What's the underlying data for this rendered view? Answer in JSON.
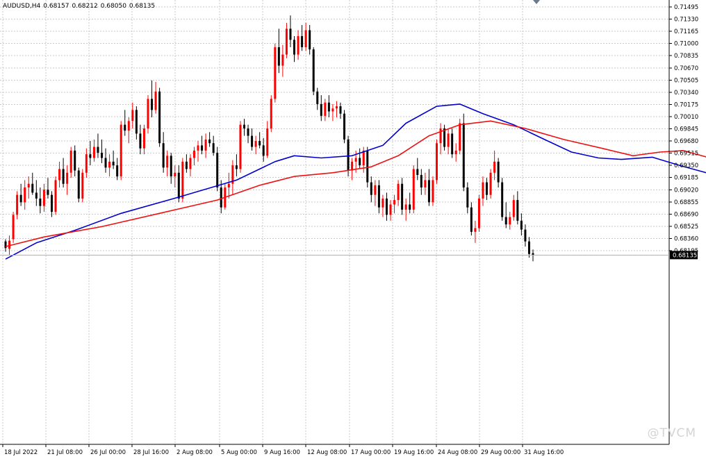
{
  "header": {
    "symbol": "AUDUSD,H4",
    "open": "0.68157",
    "high": "0.68212",
    "low": "0.68050",
    "close": "0.68135"
  },
  "watermark": "@TVCM",
  "colors": {
    "bull": "#ff0000",
    "bear": "#000000",
    "ma_fast": "#0000cc",
    "ma_slow": "#ee1111",
    "grid": "#c8c8c8",
    "price_tag_bg": "#000000",
    "price_tag_fg": "#ffffff"
  },
  "chart_data": {
    "type": "candlestick",
    "title": "",
    "symbol": "AUDUSD",
    "timeframe": "H4",
    "grid": true,
    "ylim": [
      0.6805,
      0.7157
    ],
    "y_ticks": [
      "0.71495",
      "0.71330",
      "0.71165",
      "0.71000",
      "0.70835",
      "0.70670",
      "0.70505",
      "0.70340",
      "0.70175",
      "0.70010",
      "0.69845",
      "0.69680",
      "0.69515",
      "0.69350",
      "0.69185",
      "0.69020",
      "0.68855",
      "0.68690",
      "0.68525",
      "0.68360",
      "0.68195"
    ],
    "x_ticks": [
      "18 Jul 2022",
      "21 Jul 08:00",
      "26 Jul 00:00",
      "28 Jul 16:00",
      "2 Aug 08:00",
      "5 Aug 00:00",
      "9 Aug 16:00",
      "12 Aug 08:00",
      "17 Aug 00:00",
      "19 Aug 16:00",
      "24 Aug 08:00",
      "29 Aug 00:00",
      "31 Aug 16:00"
    ],
    "current_price": "0.68135",
    "candles": [
      [
        0.6832,
        0.6835,
        0.6818,
        0.6823
      ],
      [
        0.6822,
        0.684,
        0.6814,
        0.6833
      ],
      [
        0.6835,
        0.6872,
        0.683,
        0.6868
      ],
      [
        0.6868,
        0.69,
        0.6862,
        0.6895
      ],
      [
        0.6895,
        0.691,
        0.688,
        0.6885
      ],
      [
        0.6885,
        0.6915,
        0.6875,
        0.6905
      ],
      [
        0.6905,
        0.692,
        0.689,
        0.691
      ],
      [
        0.691,
        0.6925,
        0.6895,
        0.6898
      ],
      [
        0.6898,
        0.6915,
        0.688,
        0.689
      ],
      [
        0.689,
        0.6905,
        0.687,
        0.688
      ],
      [
        0.688,
        0.691,
        0.6872,
        0.6902
      ],
      [
        0.6902,
        0.6918,
        0.689,
        0.6895
      ],
      [
        0.6895,
        0.69,
        0.6865,
        0.6872
      ],
      [
        0.6872,
        0.692,
        0.6868,
        0.6915
      ],
      [
        0.6915,
        0.694,
        0.6905,
        0.693
      ],
      [
        0.693,
        0.6945,
        0.6905,
        0.691
      ],
      [
        0.691,
        0.6935,
        0.6895,
        0.6925
      ],
      [
        0.6925,
        0.696,
        0.6918,
        0.6955
      ],
      [
        0.6955,
        0.6962,
        0.692,
        0.6928
      ],
      [
        0.6928,
        0.6932,
        0.6885,
        0.689
      ],
      [
        0.689,
        0.693,
        0.6885,
        0.6925
      ],
      [
        0.6925,
        0.6958,
        0.6918,
        0.695
      ],
      [
        0.695,
        0.6968,
        0.6935,
        0.6945
      ],
      [
        0.6945,
        0.697,
        0.694,
        0.696
      ],
      [
        0.696,
        0.6978,
        0.6945,
        0.6952
      ],
      [
        0.6952,
        0.697,
        0.6938,
        0.6945
      ],
      [
        0.6945,
        0.6958,
        0.6925,
        0.6932
      ],
      [
        0.6932,
        0.695,
        0.692,
        0.694
      ],
      [
        0.694,
        0.6955,
        0.693,
        0.6935
      ],
      [
        0.6935,
        0.6945,
        0.6915,
        0.692
      ],
      [
        0.692,
        0.6995,
        0.6915,
        0.699
      ],
      [
        0.699,
        0.701,
        0.6975,
        0.6982
      ],
      [
        0.6982,
        0.7,
        0.6965,
        0.6995
      ],
      [
        0.6995,
        0.702,
        0.6985,
        0.701
      ],
      [
        0.701,
        0.7015,
        0.697,
        0.6978
      ],
      [
        0.6978,
        0.699,
        0.695,
        0.6958
      ],
      [
        0.6958,
        0.699,
        0.695,
        0.6985
      ],
      [
        0.6985,
        0.703,
        0.6978,
        0.7025
      ],
      [
        0.7025,
        0.705,
        0.7,
        0.701
      ],
      [
        0.701,
        0.7048,
        0.7005,
        0.7035
      ],
      [
        0.7035,
        0.704,
        0.696,
        0.6965
      ],
      [
        0.6965,
        0.698,
        0.6925,
        0.6932
      ],
      [
        0.6932,
        0.6955,
        0.692,
        0.6948
      ],
      [
        0.6948,
        0.6952,
        0.691,
        0.692
      ],
      [
        0.692,
        0.6935,
        0.6905,
        0.6925
      ],
      [
        0.6925,
        0.6935,
        0.6885,
        0.689
      ],
      [
        0.689,
        0.6945,
        0.6885,
        0.694
      ],
      [
        0.694,
        0.695,
        0.6925,
        0.693
      ],
      [
        0.693,
        0.695,
        0.692,
        0.6945
      ],
      [
        0.6945,
        0.696,
        0.6935,
        0.6955
      ],
      [
        0.6955,
        0.6968,
        0.694,
        0.6962
      ],
      [
        0.6962,
        0.6975,
        0.695,
        0.6955
      ],
      [
        0.6955,
        0.6978,
        0.6945,
        0.697
      ],
      [
        0.697,
        0.698,
        0.696,
        0.6965
      ],
      [
        0.6965,
        0.6975,
        0.6948,
        0.6952
      ],
      [
        0.6952,
        0.696,
        0.69,
        0.6905
      ],
      [
        0.6905,
        0.6915,
        0.687,
        0.6878
      ],
      [
        0.6878,
        0.691,
        0.6875,
        0.6905
      ],
      [
        0.6905,
        0.6925,
        0.689,
        0.691
      ],
      [
        0.691,
        0.6942,
        0.6895,
        0.6935
      ],
      [
        0.6935,
        0.695,
        0.692,
        0.693
      ],
      [
        0.693,
        0.6995,
        0.6925,
        0.699
      ],
      [
        0.699,
        0.6998,
        0.6975,
        0.6985
      ],
      [
        0.6985,
        0.699,
        0.6965,
        0.6975
      ],
      [
        0.6975,
        0.6985,
        0.6955,
        0.696
      ],
      [
        0.696,
        0.6975,
        0.695,
        0.6968
      ],
      [
        0.6968,
        0.698,
        0.6958,
        0.6962
      ],
      [
        0.6962,
        0.6972,
        0.694,
        0.6948
      ],
      [
        0.6948,
        0.6995,
        0.6945,
        0.6985
      ],
      [
        0.6985,
        0.703,
        0.698,
        0.7025
      ],
      [
        0.7025,
        0.71,
        0.702,
        0.7095
      ],
      [
        0.7095,
        0.712,
        0.706,
        0.707
      ],
      [
        0.707,
        0.7098,
        0.7055,
        0.7085
      ],
      [
        0.7085,
        0.7128,
        0.708,
        0.712
      ],
      [
        0.712,
        0.7138,
        0.7095,
        0.7105
      ],
      [
        0.7105,
        0.711,
        0.7075,
        0.7085
      ],
      [
        0.7085,
        0.7118,
        0.7078,
        0.711
      ],
      [
        0.711,
        0.7125,
        0.709,
        0.7095
      ],
      [
        0.7095,
        0.7128,
        0.709,
        0.7118
      ],
      [
        0.7118,
        0.7125,
        0.7085,
        0.7092
      ],
      [
        0.7092,
        0.7095,
        0.703,
        0.7035
      ],
      [
        0.7035,
        0.704,
        0.701,
        0.7018
      ],
      [
        0.7018,
        0.703,
        0.6995,
        0.7002
      ],
      [
        0.7002,
        0.7025,
        0.6995,
        0.702
      ],
      [
        0.702,
        0.703,
        0.7,
        0.7008
      ],
      [
        0.7008,
        0.7018,
        0.6995,
        0.7012
      ],
      [
        0.7012,
        0.7022,
        0.7,
        0.7015
      ],
      [
        0.7015,
        0.702,
        0.6998,
        0.7005
      ],
      [
        0.7005,
        0.701,
        0.6965,
        0.697
      ],
      [
        0.697,
        0.6975,
        0.692,
        0.6928
      ],
      [
        0.6928,
        0.6945,
        0.6915,
        0.694
      ],
      [
        0.694,
        0.6955,
        0.6925,
        0.6945
      ],
      [
        0.6945,
        0.6958,
        0.693,
        0.6935
      ],
      [
        0.6935,
        0.696,
        0.6925,
        0.6955
      ],
      [
        0.6955,
        0.696,
        0.6905,
        0.6912
      ],
      [
        0.6912,
        0.692,
        0.6885,
        0.6895
      ],
      [
        0.6895,
        0.6915,
        0.688,
        0.6908
      ],
      [
        0.6908,
        0.6915,
        0.687,
        0.6878
      ],
      [
        0.6878,
        0.6895,
        0.6865,
        0.689
      ],
      [
        0.689,
        0.6898,
        0.686,
        0.6868
      ],
      [
        0.6868,
        0.6888,
        0.686,
        0.6882
      ],
      [
        0.6882,
        0.6895,
        0.687,
        0.6888
      ],
      [
        0.6888,
        0.6915,
        0.688,
        0.691
      ],
      [
        0.691,
        0.6918,
        0.6868,
        0.6875
      ],
      [
        0.6875,
        0.689,
        0.686,
        0.6882
      ],
      [
        0.6882,
        0.6898,
        0.687,
        0.6875
      ],
      [
        0.6875,
        0.6935,
        0.687,
        0.693
      ],
      [
        0.693,
        0.6945,
        0.6915,
        0.6922
      ],
      [
        0.6922,
        0.693,
        0.6895,
        0.6905
      ],
      [
        0.6905,
        0.6925,
        0.6895,
        0.6915
      ],
      [
        0.6915,
        0.693,
        0.688,
        0.6885
      ],
      [
        0.6885,
        0.692,
        0.688,
        0.6915
      ],
      [
        0.6915,
        0.697,
        0.691,
        0.6965
      ],
      [
        0.6965,
        0.6992,
        0.695,
        0.6985
      ],
      [
        0.6985,
        0.699,
        0.6955,
        0.696
      ],
      [
        0.696,
        0.6985,
        0.695,
        0.6978
      ],
      [
        0.6978,
        0.6985,
        0.6945,
        0.695
      ],
      [
        0.695,
        0.6965,
        0.694,
        0.6955
      ],
      [
        0.6955,
        0.6998,
        0.695,
        0.6992
      ],
      [
        0.6992,
        0.7005,
        0.69,
        0.6905
      ],
      [
        0.6905,
        0.6912,
        0.687,
        0.6878
      ],
      [
        0.6878,
        0.6885,
        0.684,
        0.6845
      ],
      [
        0.6845,
        0.686,
        0.683,
        0.685
      ],
      [
        0.685,
        0.6895,
        0.6845,
        0.689
      ],
      [
        0.689,
        0.692,
        0.688,
        0.6912
      ],
      [
        0.6912,
        0.6918,
        0.6888,
        0.6895
      ],
      [
        0.6895,
        0.693,
        0.689,
        0.6925
      ],
      [
        0.6925,
        0.6955,
        0.6915,
        0.694
      ],
      [
        0.694,
        0.6945,
        0.6905,
        0.6912
      ],
      [
        0.6912,
        0.6918,
        0.686,
        0.6865
      ],
      [
        0.6865,
        0.6885,
        0.685,
        0.6855
      ],
      [
        0.6855,
        0.6872,
        0.6848,
        0.6865
      ],
      [
        0.6865,
        0.6895,
        0.686,
        0.6888
      ],
      [
        0.6888,
        0.69,
        0.6855,
        0.686
      ],
      [
        0.686,
        0.687,
        0.684,
        0.6848
      ],
      [
        0.6848,
        0.6855,
        0.6825,
        0.6832
      ],
      [
        0.6832,
        0.6838,
        0.681,
        0.6815
      ],
      [
        0.6816,
        0.6821,
        0.6805,
        0.6814
      ]
    ],
    "series": [
      {
        "name": "",
        "color": "#0000cc",
        "type": "moving_average",
        "values": [
          [
            0,
            0.6808
          ],
          [
            8,
            0.683
          ],
          [
            18,
            0.6847
          ],
          [
            30,
            0.687
          ],
          [
            45,
            0.6892
          ],
          [
            60,
            0.6915
          ],
          [
            70,
            0.694
          ],
          [
            75,
            0.6948
          ],
          [
            82,
            0.6945
          ],
          [
            90,
            0.6948
          ],
          [
            98,
            0.6962
          ],
          [
            104,
            0.6992
          ],
          [
            112,
            0.7015
          ],
          [
            118,
            0.7018
          ],
          [
            124,
            0.7005
          ],
          [
            132,
            0.699
          ],
          [
            140,
            0.697
          ],
          [
            147,
            0.6953
          ],
          [
            154,
            0.6945
          ],
          [
            160,
            0.6943
          ],
          [
            168,
            0.6946
          ],
          [
            175,
            0.6935
          ],
          [
            182,
            0.6925
          ],
          [
            188,
            0.6912
          ],
          [
            192,
            0.69
          ]
        ]
      },
      {
        "name": "",
        "color": "#ee1111",
        "type": "moving_average",
        "values": [
          [
            0,
            0.6825
          ],
          [
            10,
            0.6838
          ],
          [
            25,
            0.6852
          ],
          [
            40,
            0.687
          ],
          [
            55,
            0.6888
          ],
          [
            66,
            0.6908
          ],
          [
            75,
            0.692
          ],
          [
            85,
            0.6925
          ],
          [
            95,
            0.6933
          ],
          [
            102,
            0.6948
          ],
          [
            110,
            0.6975
          ],
          [
            118,
            0.699
          ],
          [
            126,
            0.6995
          ],
          [
            135,
            0.6985
          ],
          [
            145,
            0.697
          ],
          [
            155,
            0.6958
          ],
          [
            163,
            0.6948
          ],
          [
            170,
            0.6953
          ],
          [
            176,
            0.6955
          ],
          [
            183,
            0.6945
          ],
          [
            190,
            0.6932
          ],
          [
            195,
            0.692
          ]
        ]
      }
    ]
  }
}
